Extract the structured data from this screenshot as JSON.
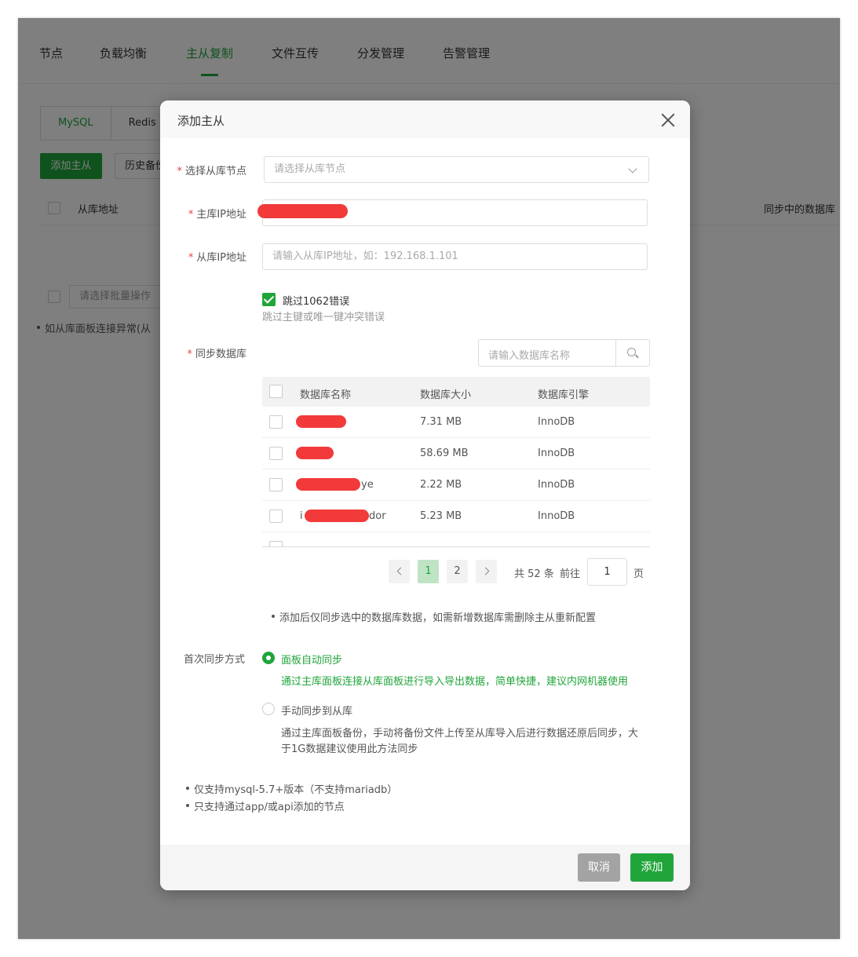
{
  "top_tabs": [
    "节点",
    "负载均衡",
    "主从复制",
    "文件互传",
    "分发管理",
    "告警管理"
  ],
  "sub_tabs": [
    "MySQL",
    "Redis"
  ],
  "background": {
    "add_button": "添加主从",
    "history_button": "历史备份",
    "col_slave_address": "从库地址",
    "col_syncing_db": "同步中的数据库",
    "batch_placeholder": "请选择批量操作",
    "note": "如从库面板连接异常(从"
  },
  "modal": {
    "title": "添加主从",
    "slave_node_label": "选择从库节点",
    "slave_node_placeholder": "请选择从库节点",
    "master_ip_label": "主库IP地址",
    "slave_ip_label": "从库IP地址",
    "slave_ip_placeholder": "请输入从库IP地址，如：192.168.1.101",
    "skip_error_label": "跳过1062错误",
    "skip_error_hint": "跳过主键或唯一键冲突错误",
    "sync_db_label": "同步数据库",
    "db_search_placeholder": "请输入数据库名称",
    "table_headers": [
      "数据库名称",
      "数据库大小",
      "数据库引擎"
    ],
    "rows": [
      {
        "name": "",
        "size": "7.31 MB",
        "engine": "InnoDB"
      },
      {
        "name": "",
        "size": "58.69 MB",
        "engine": "InnoDB"
      },
      {
        "name": "ye",
        "size": "2.22 MB",
        "engine": "InnoDB"
      },
      {
        "name": "i",
        "name_suffix": "dor",
        "size": "5.23 MB",
        "engine": "InnoDB"
      }
    ],
    "pagination": {
      "pages": [
        "1",
        "2"
      ],
      "current_page": "1",
      "total": "共 52 条",
      "goto_label": "前往",
      "goto_value": "1",
      "page_suffix": "页"
    },
    "db_note": "添加后仅同步选中的数据库数据，如需新增数据库需删除主从重新配置",
    "first_sync_label": "首次同步方式",
    "sync_auto_label": "面板自动同步",
    "sync_auto_desc": "通过主库面板连接从库面板进行导入导出数据，简单快捷，建议内网机器使用",
    "sync_manual_label": "手动同步到从库",
    "sync_manual_desc_1": "通过主库面板备份，手动将备份文件上传至从库导入后进行数据还原后同步，大",
    "sync_manual_desc_2": "于1G数据建议使用此方法同步",
    "tips": [
      "仅支持mysql-5.7+版本（不支持mariadb）",
      "只支持通过app/或api添加的节点"
    ],
    "cancel_button": "取消",
    "add_button": "添加"
  },
  "colors": {
    "accent": "#20a53a",
    "required": "#e54545",
    "cancel": "#a3a3a3"
  }
}
